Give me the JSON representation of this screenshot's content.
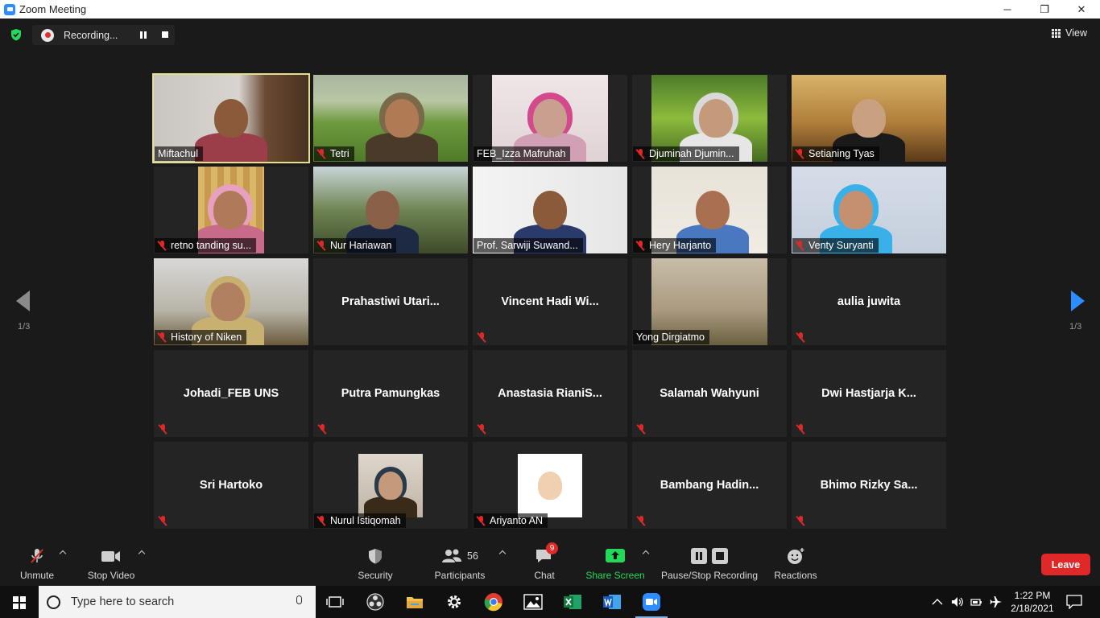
{
  "window": {
    "title": "Zoom Meeting",
    "minimize": "─",
    "restore": "❐",
    "close": "✕"
  },
  "recording": {
    "label": "Recording..."
  },
  "view": {
    "label": "View"
  },
  "pagination": {
    "left": "1/3",
    "right": "1/3"
  },
  "participants": [
    {
      "name": "Miftachul",
      "video": true,
      "muted": false,
      "active": true
    },
    {
      "name": "Tetri",
      "video": true,
      "muted": true
    },
    {
      "name": "FEB_Izza Mafruhah",
      "video": true,
      "muted": false
    },
    {
      "name": "Djuminah Djumin...",
      "video": true,
      "muted": true
    },
    {
      "name": "Setianing Tyas",
      "video": true,
      "muted": true
    },
    {
      "name": "retno tanding su...",
      "video": true,
      "muted": true
    },
    {
      "name": "Nur Hariawan",
      "video": true,
      "muted": true
    },
    {
      "name": "Prof. Sarwiji Suwand...",
      "video": true,
      "muted": false
    },
    {
      "name": "Hery Harjanto",
      "video": true,
      "muted": true
    },
    {
      "name": "Venty Suryanti",
      "video": true,
      "muted": true
    },
    {
      "name": "History of Niken",
      "video": true,
      "muted": true
    },
    {
      "name": "Prahastiwi  Utari...",
      "video": false,
      "muted": false
    },
    {
      "name": "Vincent  Hadi  Wi...",
      "video": false,
      "muted": true
    },
    {
      "name": "Yong Dirgiatmo",
      "video": true,
      "muted": false
    },
    {
      "name": "aulia juwita",
      "video": false,
      "muted": true
    },
    {
      "name": "Johadi_FEB UNS",
      "video": false,
      "muted": true
    },
    {
      "name": "Putra Pamungkas",
      "video": false,
      "muted": true
    },
    {
      "name": "Anastasia  RianiS...",
      "video": false,
      "muted": true
    },
    {
      "name": "Salamah Wahyuni",
      "video": false,
      "muted": true
    },
    {
      "name": "Dwi  Hastjarja  K...",
      "video": false,
      "muted": true
    },
    {
      "name": "Sri Hartoko",
      "video": false,
      "muted": true
    },
    {
      "name": "Nurul Istiqomah",
      "video": false,
      "photo": true,
      "muted": true
    },
    {
      "name": "Ariyanto AN",
      "video": false,
      "photo": true,
      "muted": true
    },
    {
      "name": "Bambang  Hadin...",
      "video": false,
      "muted": true
    },
    {
      "name": "Bhimo  Rizky  Sa...",
      "video": false,
      "muted": true
    }
  ],
  "toolbar": {
    "unmute": "Unmute",
    "stop_video": "Stop Video",
    "security": "Security",
    "participants": "Participants",
    "participants_count": "56",
    "chat": "Chat",
    "chat_badge": "9",
    "share_screen": "Share Screen",
    "pause_stop_recording": "Pause/Stop Recording",
    "reactions": "Reactions",
    "leave": "Leave"
  },
  "colors": {
    "accent": "#2d8cff",
    "share": "#23d959",
    "leave": "#e02828",
    "active_speaker": "#e3e08a"
  },
  "taskbar": {
    "search_placeholder": "Type here to search",
    "time": "1:22 PM",
    "date": "2/18/2021"
  }
}
